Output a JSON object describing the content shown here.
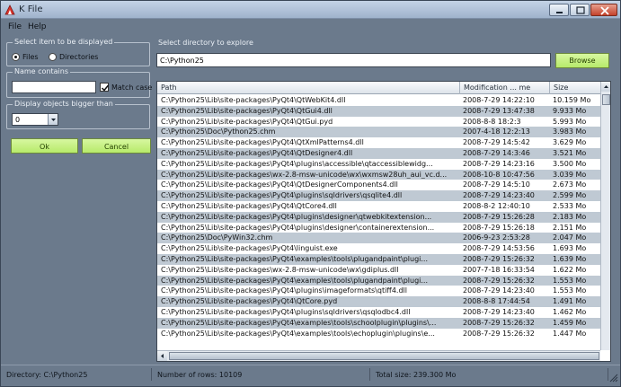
{
  "window": {
    "title": "K File"
  },
  "menu": [
    "File",
    "Help"
  ],
  "left_panel": {
    "display_group_title": "Select item to be displayed",
    "radio_files": "Files",
    "radio_directories": "Directories",
    "radio_selected": "Files",
    "name_group_title": "Name contains",
    "name_value": "",
    "match_case_label": "Match case",
    "match_case_checked": true,
    "size_group_title": "Display objects bigger than",
    "size_value": "0",
    "ok_label": "Ok",
    "cancel_label": "Cancel"
  },
  "directory": {
    "label": "Select directory to explore",
    "value": "C:\\Python25",
    "browse_label": "Browse"
  },
  "table": {
    "headers": [
      "Path",
      "Modification ... me",
      "Size"
    ],
    "rows": [
      [
        "C:\\Python25\\Lib\\site-packages\\PyQt4\\QtWebKit4.dll",
        "2008-7-29 14:22:10",
        "10.159 Mo"
      ],
      [
        "C:\\Python25\\Lib\\site-packages\\PyQt4\\QtGui4.dll",
        "2008-7-29 13:47:38",
        "9.933 Mo"
      ],
      [
        "C:\\Python25\\Lib\\site-packages\\PyQt4\\QtGui.pyd",
        "2008-8-8 18:2:3",
        "5.993 Mo"
      ],
      [
        "C:\\Python25\\Doc\\Python25.chm",
        "2007-4-18 12:2:13",
        "3.983 Mo"
      ],
      [
        "C:\\Python25\\Lib\\site-packages\\PyQt4\\QtXmlPatterns4.dll",
        "2008-7-29 14:5:42",
        "3.629 Mo"
      ],
      [
        "C:\\Python25\\Lib\\site-packages\\PyQt4\\QtDesigner4.dll",
        "2008-7-29 14:3:46",
        "3.521 Mo"
      ],
      [
        "C:\\Python25\\Lib\\site-packages\\PyQt4\\plugins\\accessible\\qtaccessiblewidg...",
        "2008-7-29 14:23:16",
        "3.500 Mo"
      ],
      [
        "C:\\Python25\\Lib\\site-packages\\wx-2.8-msw-unicode\\wx\\wxmsw28uh_aui_vc.d...",
        "2008-10-8 10:47:56",
        "3.039 Mo"
      ],
      [
        "C:\\Python25\\Lib\\site-packages\\PyQt4\\QtDesignerComponents4.dll",
        "2008-7-29 14:5:10",
        "2.673 Mo"
      ],
      [
        "C:\\Python25\\Lib\\site-packages\\PyQt4\\plugins\\sqldrivers\\qsqlite4.dll",
        "2008-7-29 14:23:40",
        "2.599 Mo"
      ],
      [
        "C:\\Python25\\Lib\\site-packages\\PyQt4\\QtCore4.dll",
        "2008-8-2 12:40:10",
        "2.533 Mo"
      ],
      [
        "C:\\Python25\\Lib\\site-packages\\PyQt4\\plugins\\designer\\qtwebkitextension...",
        "2008-7-29 15:26:28",
        "2.183 Mo"
      ],
      [
        "C:\\Python25\\Lib\\site-packages\\PyQt4\\plugins\\designer\\containerextension...",
        "2008-7-29 15:26:18",
        "2.151 Mo"
      ],
      [
        "C:\\Python25\\Doc\\PyWin32.chm",
        "2006-9-23 2:53:28",
        "2.047 Mo"
      ],
      [
        "C:\\Python25\\Lib\\site-packages\\PyQt4\\linguist.exe",
        "2008-7-29 14:53:56",
        "1.693 Mo"
      ],
      [
        "C:\\Python25\\Lib\\site-packages\\PyQt4\\examples\\tools\\plugandpaint\\plugi...",
        "2008-7-29 15:26:32",
        "1.639 Mo"
      ],
      [
        "C:\\Python25\\Lib\\site-packages\\wx-2.8-msw-unicode\\wx\\gdiplus.dll",
        "2007-7-18 16:33:54",
        "1.622 Mo"
      ],
      [
        "C:\\Python25\\Lib\\site-packages\\PyQt4\\examples\\tools\\plugandpaint\\plugi...",
        "2008-7-29 15:26:32",
        "1.553 Mo"
      ],
      [
        "C:\\Python25\\Lib\\site-packages\\PyQt4\\plugins\\imageformats\\qtiff4.dll",
        "2008-7-29 14:23:40",
        "1.553 Mo"
      ],
      [
        "C:\\Python25\\Lib\\site-packages\\PyQt4\\QtCore.pyd",
        "2008-8-8 17:44:54",
        "1.491 Mo"
      ],
      [
        "C:\\Python25\\Lib\\site-packages\\PyQt4\\plugins\\sqldrivers\\qsqlodbc4.dll",
        "2008-7-29 14:23:40",
        "1.462 Mo"
      ],
      [
        "C:\\Python25\\Lib\\site-packages\\PyQt4\\examples\\tools\\schoolplugin\\plugins\\...",
        "2008-7-29 15:26:32",
        "1.459 Mo"
      ],
      [
        "C:\\Python25\\Lib\\site-packages\\PyQt4\\examples\\tools\\echoplugin\\plugins\\e...",
        "2008-7-29 15:26:32",
        "1.447 Mo"
      ]
    ]
  },
  "status": {
    "directory": "Directory: C:\\Python25",
    "rows": "Number of rows: 10109",
    "total_size": "Total size: 239.300 Mo"
  },
  "colors": {
    "window_bg": "#6b7a8c",
    "button_green": "#c3ef80",
    "row_alt": "#bfc9d3"
  }
}
